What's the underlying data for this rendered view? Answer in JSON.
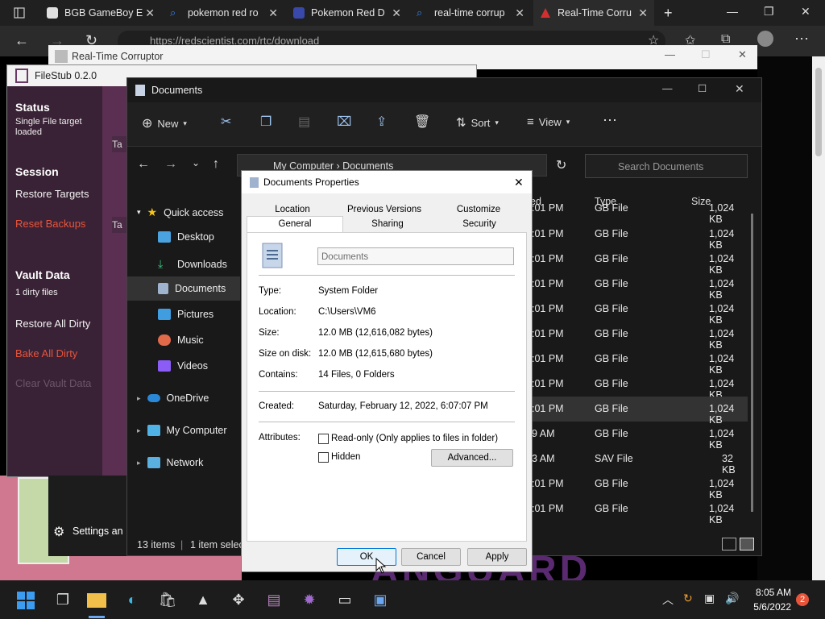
{
  "browser": {
    "tabs": [
      {
        "label": "BGB GameBoy E",
        "fav_color": "#e0e0e0"
      },
      {
        "label": "pokemon red ro",
        "fav_color": "#3b82f6"
      },
      {
        "label": "Pokemon Red D",
        "fav_color": "#3949ab"
      },
      {
        "label": "real-time corrup",
        "fav_color": "#3b82f6"
      },
      {
        "label": "Real-Time Corru",
        "fav_color": "#d32f2f"
      }
    ],
    "url": "https://redscientist.com/rtc/download"
  },
  "rtc_window": {
    "title": "Real-Time Corruptor"
  },
  "background_text": {
    "brand_fragment": "ANGUARD"
  },
  "filestub": {
    "title": "FileStub 0.2.0",
    "status_heading": "Status",
    "status_text": "Single File target loaded",
    "session_heading": "Session",
    "restore_targets": "Restore Targets",
    "reset_backups": "Reset Backups",
    "vault_heading": "Vault Data",
    "vault_text": "1 dirty files",
    "restore_all_dirty": "Restore All Dirty",
    "bake_all_dirty": "Bake All Dirty",
    "clear_vault_data": "Clear Vault Data",
    "settings": "Settings an",
    "tab_t1": "Ta",
    "tab_t2": "Ta"
  },
  "explorer": {
    "title": "Documents",
    "toolbar": {
      "new": "New",
      "sort": "Sort",
      "view": "View"
    },
    "breadcrumb": {
      "root": "My Computer",
      "current": "Documents"
    },
    "search_placeholder": "Search Documents",
    "nav": {
      "quick_access": "Quick access",
      "desktop": "Desktop",
      "downloads": "Downloads",
      "documents": "Documents",
      "pictures": "Pictures",
      "music": "Music",
      "videos": "Videos",
      "onedrive": "OneDrive",
      "my_computer": "My Computer",
      "network": "Network"
    },
    "columns": {
      "modified": "ed",
      "type": "Type",
      "size": "Size"
    },
    "rows": [
      {
        "time": ":01 PM",
        "type": "GB File",
        "size": "1,024 KB"
      },
      {
        "time": ":01 PM",
        "type": "GB File",
        "size": "1,024 KB"
      },
      {
        "time": ":01 PM",
        "type": "GB File",
        "size": "1,024 KB"
      },
      {
        "time": ":01 PM",
        "type": "GB File",
        "size": "1,024 KB"
      },
      {
        "time": ":01 PM",
        "type": "GB File",
        "size": "1,024 KB"
      },
      {
        "time": ":01 PM",
        "type": "GB File",
        "size": "1,024 KB"
      },
      {
        "time": ":01 PM",
        "type": "GB File",
        "size": "1,024 KB"
      },
      {
        "time": ":01 PM",
        "type": "GB File",
        "size": "1,024 KB"
      },
      {
        "time": ":01 PM",
        "type": "GB File",
        "size": "1,024 KB"
      },
      {
        "time": "9 AM",
        "type": "GB File",
        "size": "1,024 KB"
      },
      {
        "time": "3 AM",
        "type": "SAV File",
        "size": "32 KB"
      },
      {
        "time": ":01 PM",
        "type": "GB File",
        "size": "1,024 KB"
      },
      {
        "time": ":01 PM",
        "type": "GB File",
        "size": "1,024 KB"
      }
    ],
    "status": {
      "items": "13 items",
      "selected": "1 item selec"
    }
  },
  "properties": {
    "title": "Documents Properties",
    "tabs_top": [
      "Location",
      "Previous Versions",
      "Customize"
    ],
    "tabs_bottom": [
      "General",
      "Sharing",
      "Security"
    ],
    "name_field": "Documents",
    "type_label": "Type:",
    "type_value": "System Folder",
    "location_label": "Location:",
    "location_value": "C:\\Users\\VM6",
    "size_label": "Size:",
    "size_value": "12.0 MB (12,616,082 bytes)",
    "size_on_disk_label": "Size on disk:",
    "size_on_disk_value": "12.0 MB (12,615,680 bytes)",
    "contains_label": "Contains:",
    "contains_value": "14 Files, 0 Folders",
    "created_label": "Created:",
    "created_value": "Saturday, February 12, 2022, 6:07:07 PM",
    "attributes_label": "Attributes:",
    "readonly_label": "Read-only (Only applies to files in folder)",
    "hidden_label": "Hidden",
    "advanced_button": "Advanced...",
    "ok_button": "OK",
    "cancel_button": "Cancel",
    "apply_button": "Apply"
  },
  "taskbar": {
    "time": "8:05 AM",
    "date": "5/6/2022",
    "notification_count": "2"
  }
}
